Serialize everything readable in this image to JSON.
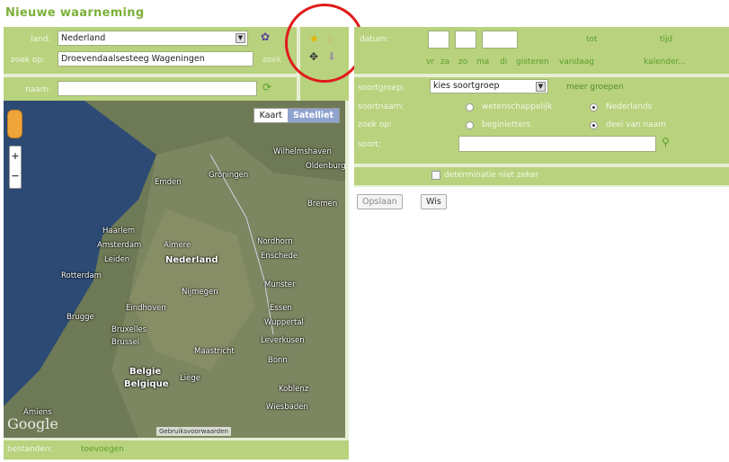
{
  "page_title": "Nieuwe waarneming",
  "location": {
    "land_label": "land:",
    "land_value": "Nederland",
    "zoek_op_label": "zoek op:",
    "zoek_op_value": "Droevendaalsesteeg Wageningen",
    "zoek_link": "zoek",
    "naam_label": "naam:",
    "naam_value": ""
  },
  "map": {
    "map_button": "Kaart",
    "satellite_button": "Satelliet",
    "logo": "Google",
    "attribution": "Gebruiksvoorwaarden",
    "cities": [
      {
        "name": "Groningen",
        "big": false
      },
      {
        "name": "Amsterdam",
        "big": false
      },
      {
        "name": "Almere",
        "big": false
      },
      {
        "name": "Leiden",
        "big": false
      },
      {
        "name": "Nederland",
        "big": true
      },
      {
        "name": "Rotterdam",
        "big": false
      },
      {
        "name": "Nijmegen",
        "big": false
      },
      {
        "name": "Enschede",
        "big": false
      },
      {
        "name": "Nordhorn",
        "big": false
      },
      {
        "name": "Munster",
        "big": false
      },
      {
        "name": "Eindhoven",
        "big": false
      },
      {
        "name": "Essen",
        "big": false
      },
      {
        "name": "Brugge",
        "big": false
      },
      {
        "name": "Brussel",
        "big": false
      },
      {
        "name": "Belgie",
        "big": true
      },
      {
        "name": "Belgique",
        "big": true
      },
      {
        "name": "Maastricht",
        "big": false
      },
      {
        "name": "Bonn",
        "big": false
      },
      {
        "name": "Koblenz",
        "big": false
      },
      {
        "name": "Wiesbaden",
        "big": false
      },
      {
        "name": "Liège",
        "big": false
      },
      {
        "name": "Wuppertal",
        "big": false
      },
      {
        "name": "Leverkusen",
        "big": false
      },
      {
        "name": "Bremen",
        "big": false
      },
      {
        "name": "Oldenburg",
        "big": false
      },
      {
        "name": "Wilhelmshaven",
        "big": false
      },
      {
        "name": "Emden",
        "big": false
      },
      {
        "name": "Haarlem",
        "big": false
      },
      {
        "name": "Amiens",
        "big": false
      },
      {
        "name": "Bruxelles",
        "big": false
      }
    ]
  },
  "files": {
    "label": "bestanden:",
    "add_link": "toevoegen"
  },
  "date": {
    "datum_label": "datum:",
    "tot_label": "tot",
    "tijd_label": "tijd",
    "shortcuts": [
      "vr",
      "za",
      "zo",
      "ma",
      "di",
      "gisteren",
      "vandaag"
    ],
    "calendar_link": "kalender..."
  },
  "species": {
    "soortgroep_label": "soortgroep:",
    "soortgroep_value": "kies soortgroep",
    "meer_groepen": "meer groepen",
    "soortnaam_label": "soortnaam:",
    "wetenschappelijk": "wetenschappelijk",
    "nederlands": "Nederlands",
    "zoek_op_label": "zoek op:",
    "beginletters": "beginletters",
    "deel_van_naam": "deel van naam",
    "soort_label": "soort:",
    "soort_value": "",
    "determinatie": "determinatie niet zeker"
  },
  "buttons": {
    "save": "Opslaan",
    "clear": "Wis"
  },
  "colors": {
    "accent": "#7cb03a",
    "row_bg": "#b9d27e",
    "panel_bg": "#e6efd2",
    "highlight_circle": "#e01b1b"
  }
}
